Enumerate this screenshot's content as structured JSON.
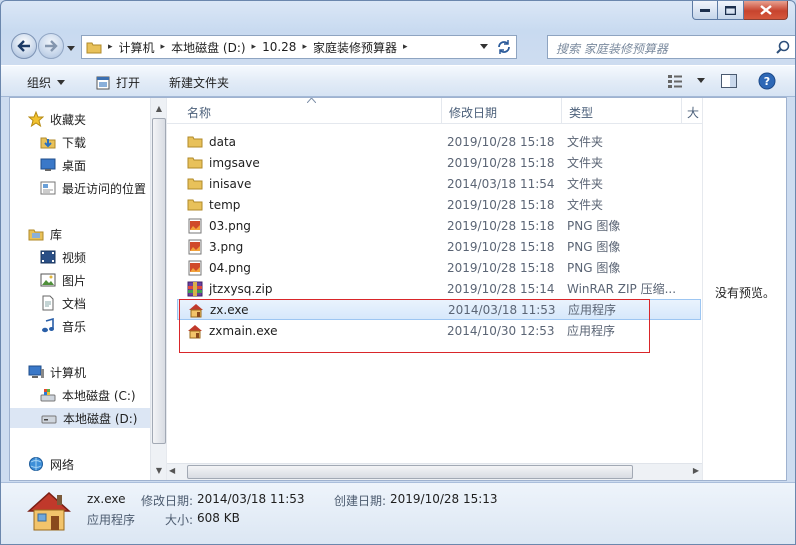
{
  "window": {
    "caption_buttons": [
      "minimize",
      "maximize",
      "close"
    ]
  },
  "address": {
    "segments": [
      "计算机",
      "本地磁盘 (D:)",
      "10.28",
      "家庭装修预算器"
    ],
    "search_placeholder": "搜索 家庭装修预算器"
  },
  "toolbar": {
    "organize": "组织",
    "open": "打开",
    "new_folder": "新建文件夹"
  },
  "sidebar": {
    "favorites": "收藏夹",
    "downloads": "下载",
    "desktop": "桌面",
    "recent": "最近访问的位置",
    "libraries": "库",
    "videos": "视频",
    "pictures": "图片",
    "documents": "文档",
    "music": "音乐",
    "computer": "计算机",
    "drive_c": "本地磁盘 (C:)",
    "drive_d": "本地磁盘 (D:)",
    "network": "网络"
  },
  "columns": {
    "name": "名称",
    "date": "修改日期",
    "type": "类型",
    "size": "大"
  },
  "files": [
    {
      "name": "data",
      "date": "2019/10/28 15:18",
      "type": "文件夹",
      "icon": "folder-icon"
    },
    {
      "name": "imgsave",
      "date": "2019/10/28 15:18",
      "type": "文件夹",
      "icon": "folder-icon"
    },
    {
      "name": "inisave",
      "date": "2014/03/18 11:54",
      "type": "文件夹",
      "icon": "folder-icon"
    },
    {
      "name": "temp",
      "date": "2019/10/28 15:18",
      "type": "文件夹",
      "icon": "folder-icon"
    },
    {
      "name": "03.png",
      "date": "2019/10/28 15:18",
      "type": "PNG 图像",
      "icon": "image-icon"
    },
    {
      "name": "3.png",
      "date": "2019/10/28 15:18",
      "type": "PNG 图像",
      "icon": "image-icon"
    },
    {
      "name": "04.png",
      "date": "2019/10/28 15:18",
      "type": "PNG 图像",
      "icon": "image-icon"
    },
    {
      "name": "jtzxysq.zip",
      "date": "2019/10/28 15:14",
      "type": "WinRAR ZIP 压缩...",
      "icon": "archive-icon"
    },
    {
      "name": "zx.exe",
      "date": "2014/03/18 11:53",
      "type": "应用程序",
      "icon": "house-icon"
    },
    {
      "name": "zxmain.exe",
      "date": "2014/10/30 12:53",
      "type": "应用程序",
      "icon": "house-icon"
    }
  ],
  "preview": {
    "text": "没有预览。"
  },
  "details": {
    "filename": "zx.exe",
    "modified_label": "修改日期:",
    "modified_value": "2014/03/18 11:53",
    "created_label": "创建日期:",
    "created_value": "2019/10/28 15:13",
    "kind": "应用程序",
    "size_label": "大小:",
    "size_value": "608 KB"
  },
  "colors": {
    "selection_border": "#9dc6f2",
    "highlight_box": "#d9262a",
    "folder": "#e8c15a"
  }
}
